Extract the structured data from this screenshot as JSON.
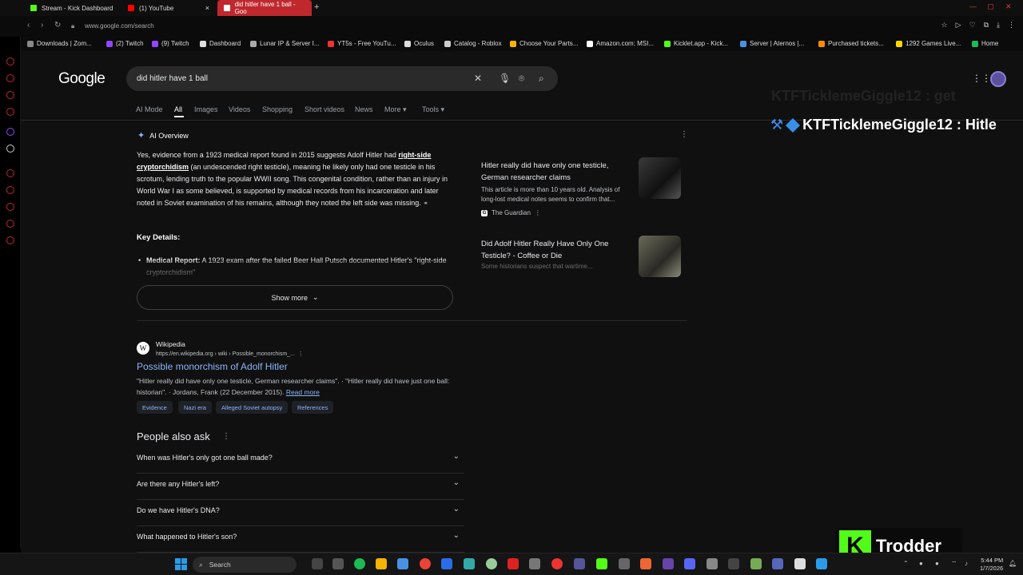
{
  "browser": {
    "tabs": [
      {
        "label": "Stream - Kick Dashboard",
        "color": "#53fc18"
      },
      {
        "label": "(1) YouTube",
        "color": "#ff0000"
      },
      {
        "label": "did hitler have 1 ball - Goo",
        "color": "#ffffff"
      }
    ],
    "new_tab": "+",
    "url": "www.google.com/search",
    "bookmarks": [
      {
        "label": "Downloads | Zom...",
        "color": "#888"
      },
      {
        "label": "(2) Twitch",
        "color": "#9146ff"
      },
      {
        "label": "(9) Twitch",
        "color": "#9146ff"
      },
      {
        "label": "Dashboard",
        "color": "#ddd"
      },
      {
        "label": "Lunar IP & Server I...",
        "color": "#aaa"
      },
      {
        "label": "YT5s - Free YouTu...",
        "color": "#e33"
      },
      {
        "label": "Oculus",
        "color": "#ddd"
      },
      {
        "label": "Catalog - Roblox",
        "color": "#ccc"
      },
      {
        "label": "Choose Your Parts...",
        "color": "#f4b400"
      },
      {
        "label": "Amazon.com: MSI...",
        "color": "#fff"
      },
      {
        "label": "Kicklet.app - Kick...",
        "color": "#53fc18"
      },
      {
        "label": "Server | Aternos |...",
        "color": "#4a90e2"
      },
      {
        "label": "Purchased tickets...",
        "color": "#ff8a00"
      },
      {
        "label": "1292 Games Live...",
        "color": "#ffd700"
      },
      {
        "label": "Home",
        "color": "#1db954"
      }
    ]
  },
  "google": {
    "logo": "Google",
    "query": "did hitler have 1 ball",
    "filters": [
      "AI Mode",
      "All",
      "Images",
      "Videos",
      "Shopping",
      "Short videos",
      "News",
      "More ▾",
      "Tools ▾"
    ],
    "ai_overview": {
      "heading": "AI Overview",
      "p1": "Yes, evidence from a 1923 medical report found in 2015 suggests Adolf Hitler had ",
      "p1_bold": "right-side cryptorchidism",
      "p2": " (an undescended right testicle), meaning he likely only had one testicle in his scrotum, lending truth to the popular WWII song. This congenital condition, rather than an injury in World War I as some believed, is supported by medical records from his incarceration and later noted in Soviet examination of his remains, although they noted the left side was missing.",
      "key_details": "Key Details:",
      "bullet_label": "Medical Report:",
      "bullet_text": " A 1923 exam after the failed Beer Hall Putsch documented Hitler's \"right-side cryptorchidism\"",
      "show_more": "Show more"
    },
    "cards": [
      {
        "title": "Hitler really did have only one testicle, German researcher claims",
        "desc": "This article is more than 10 years old. Analysis of long-lost medical notes seems to confirm that...",
        "source": "The Guardian"
      },
      {
        "title": "Did Adolf Hitler Really Have Only One Testicle? - Coffee or Die",
        "desc": "Some historians suspect that wartime...",
        "source": ""
      }
    ],
    "result": {
      "site": "Wikipedia",
      "url": "https://en.wikipedia.org › wiki › Possible_monorchism_...",
      "title": "Possible monorchism of Adolf Hitler",
      "snippet": "\"Hitler really did have only one testicle, German researcher claims\". · \"Hitler really did have just one ball: historian\". · Jordans, Frank (22 December 2015).",
      "read_more": "Read more",
      "chips": [
        "Evidence",
        "Nazi era",
        "Alleged Soviet autopsy",
        "References"
      ]
    },
    "paa": {
      "title": "People also ask",
      "questions": [
        "When was Hitler's only got one ball made?",
        "Are there any Hitler's left?",
        "Do we have Hitler's DNA?",
        "What happened to Hitler's son?"
      ]
    }
  },
  "overlay": {
    "chat_ghost": "KTFTicklemeGiggle12 : get",
    "chat": "KTFTicklemeGiggle12 : Hitle",
    "brand": "Trodder"
  },
  "taskbar": {
    "search": "Search",
    "time": "5:44 PM",
    "date": "1/7/2026"
  }
}
